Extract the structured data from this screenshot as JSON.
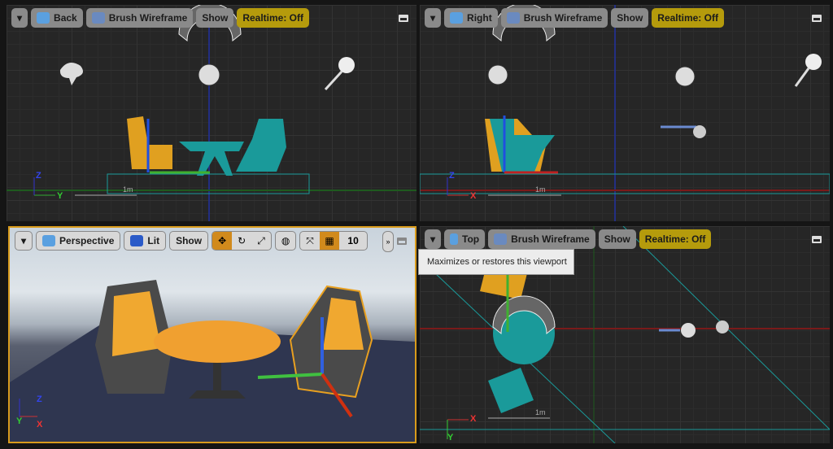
{
  "viewports": [
    {
      "name": "back",
      "view_label": "Back",
      "mode_label": "Brush Wireframe",
      "show_label": "Show",
      "realtime_label": "Realtime: Off",
      "axes": [
        "Z",
        "Y"
      ],
      "scale": "1m"
    },
    {
      "name": "right",
      "view_label": "Right",
      "mode_label": "Brush Wireframe",
      "show_label": "Show",
      "realtime_label": "Realtime: Off",
      "axes": [
        "Z",
        "X"
      ],
      "scale": "1m"
    },
    {
      "name": "perspective",
      "view_label": "Perspective",
      "mode_label": "Lit",
      "show_label": "Show",
      "grid_snap": "10",
      "axes": [
        "Z",
        "Y",
        "X"
      ],
      "active": true
    },
    {
      "name": "top",
      "view_label": "Top",
      "mode_label": "Brush Wireframe",
      "show_label": "Show",
      "realtime_label": "Realtime: Off",
      "axes": [
        "Y",
        "X"
      ],
      "scale": "1m"
    }
  ],
  "tooltip": "Maximizes or restores this viewport",
  "colors": {
    "realtime": "#b59b0c",
    "active_tool": "#d18a1c",
    "active_border": "#d89b1c",
    "selection": "#1a9a9a"
  }
}
